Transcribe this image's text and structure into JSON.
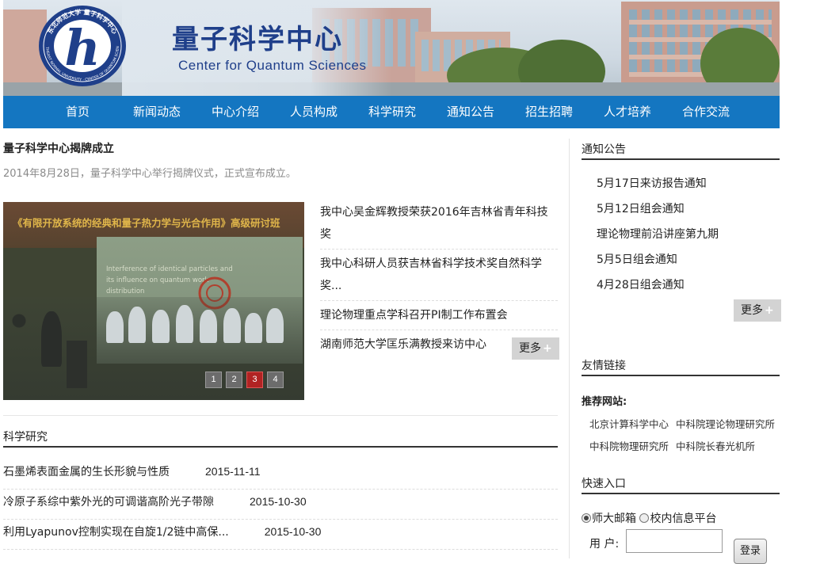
{
  "header": {
    "logo_ring_text_top": "东北师范大学 量子科学中心",
    "logo_ring_text_bottom": "NORTHEAST NORMAL UNIVERSITY · CENTER OF QUANTUM SCIENCES",
    "logo_monogram": "h",
    "title_cn": "量子科学中心",
    "title_en": "Center for Quantum Sciences"
  },
  "nav": {
    "items": [
      "首页",
      "新闻动态",
      "中心介绍",
      "人员构成",
      "科学研究",
      "通知公告",
      "招生招聘",
      "人才培养",
      "合作交流"
    ]
  },
  "headline": {
    "title": "量子科学中心揭牌成立",
    "desc": "2014年8月28日，量子科学中心举行揭牌仪式，正式宣布成立。"
  },
  "slider": {
    "caption": "《有限开放系统的经典和量子热力学与光合作用》高级研讨班",
    "screen_text": "Interference of identical particles and its influence on quantum work distribution",
    "pages": [
      "1",
      "2",
      "3",
      "4"
    ],
    "active_page": "3"
  },
  "news": {
    "items": [
      "我中心吴金辉教授荣获2016年吉林省青年科技奖",
      "我中心科研人员获吉林省科学技术奖自然科学奖...",
      "理论物理重点学科召开PI制工作布置会",
      "湖南师范大学匡乐满教授来访中心"
    ],
    "more_label": "更多",
    "more_plus": "+"
  },
  "research": {
    "title": "科学研究",
    "items": [
      {
        "title": "石墨烯表面金属的生长形貌与性质",
        "date": "2015-11-11"
      },
      {
        "title": "冷原子系综中紫外光的可调谐高阶光子带隙",
        "date": "2015-10-30"
      },
      {
        "title": "利用Lyapunov控制实现在自旋1/2链中高保...",
        "date": "2015-10-30"
      }
    ]
  },
  "notices": {
    "title": "通知公告",
    "items": [
      "5月17日来访报告通知",
      "5月12日组会通知",
      "理论物理前沿讲座第九期",
      "5月5日组会通知",
      "4月28日组会通知"
    ],
    "more_label": "更多",
    "more_plus": "+"
  },
  "links": {
    "title": "友情链接",
    "label": "推荐网站:",
    "items": [
      "北京计算科学中心",
      "中科院理论物理研究所",
      "中科院物理研究所",
      "中科院长春光机所"
    ]
  },
  "quick_entry": {
    "title": "快速入口",
    "options": [
      "师大邮箱",
      "校内信息平台"
    ],
    "selected": "师大邮箱",
    "user_label": "用 户:",
    "login_label": "登录"
  },
  "colors": {
    "nav_bg": "#1476c1",
    "brand_blue": "#1f3f8a",
    "active_dot": "#b12323"
  }
}
